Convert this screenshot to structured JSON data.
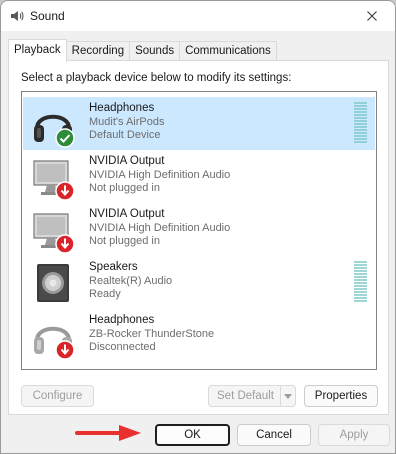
{
  "window": {
    "title": "Sound",
    "icon": "speaker-icon"
  },
  "tabs": [
    {
      "label": "Playback",
      "active": true
    },
    {
      "label": "Recording",
      "active": false
    },
    {
      "label": "Sounds",
      "active": false
    },
    {
      "label": "Communications",
      "active": false
    }
  ],
  "playback": {
    "instruction": "Select a playback device below to modify its settings:",
    "devices": [
      {
        "name": "Headphones",
        "line2": "Mudit's AirPods",
        "line3": "Default Device",
        "icon": "headphones-icon",
        "status": "default-check",
        "selected": true
      },
      {
        "name": "NVIDIA Output",
        "line2": "NVIDIA High Definition Audio",
        "line3": "Not plugged in",
        "icon": "monitor-icon",
        "status": "unplugged-arrow",
        "selected": false
      },
      {
        "name": "NVIDIA Output",
        "line2": "NVIDIA High Definition Audio",
        "line3": "Not plugged in",
        "icon": "monitor-icon",
        "status": "unplugged-arrow",
        "selected": false
      },
      {
        "name": "Speakers",
        "line2": "Realtek(R) Audio",
        "line3": "Ready",
        "icon": "speaker-box-icon",
        "status": "none",
        "selected": false
      },
      {
        "name": "Headphones",
        "line2": "ZB-Rocker ThunderStone",
        "line3": "Disconnected",
        "icon": "headphones-icon",
        "status": "unplugged-arrow",
        "selected": false
      }
    ],
    "configure_label": "Configure",
    "set_default_label": "Set Default",
    "properties_label": "Properties"
  },
  "footer": {
    "ok_label": "OK",
    "cancel_label": "Cancel",
    "apply_label": "Apply"
  },
  "colors": {
    "selection": "#cce8ff",
    "check_badge": "#2e8b3a",
    "unplugged_badge": "#d9252a",
    "annotation_arrow": "#e8312f",
    "meter": "#7ec8c8"
  }
}
